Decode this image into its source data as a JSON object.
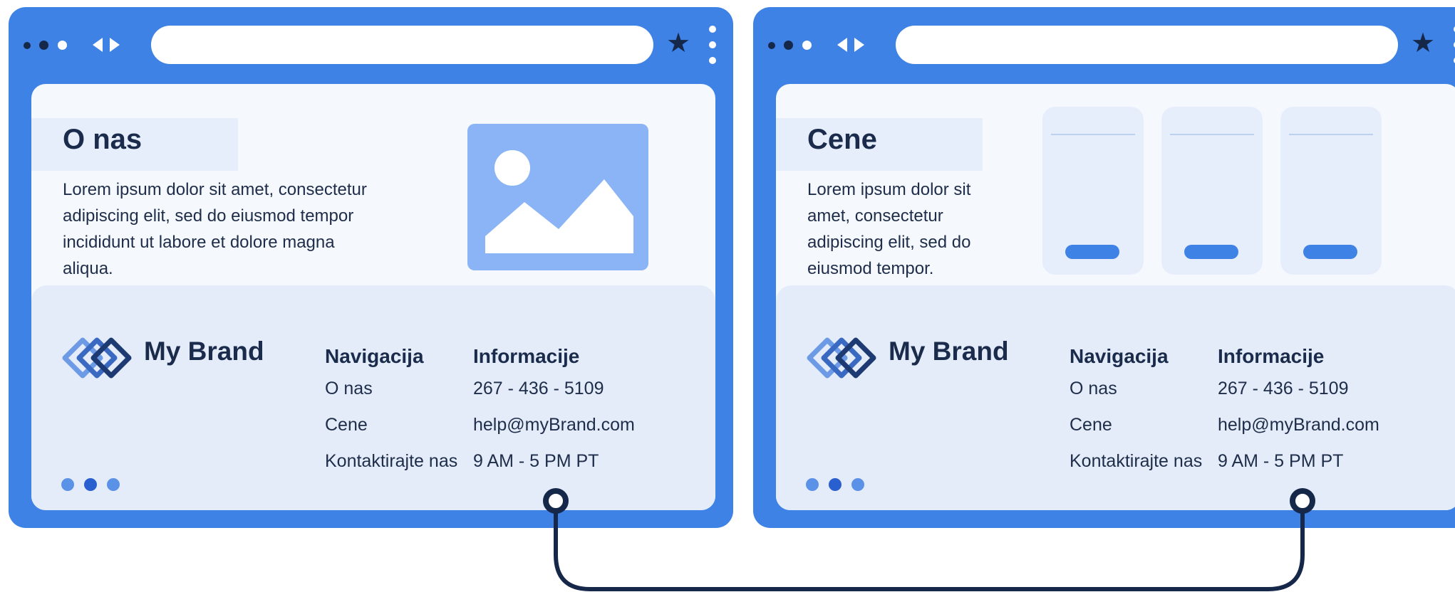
{
  "colors": {
    "window_frame": "#3f82e5",
    "content_bg": "#f5f8fd",
    "footer_bg": "#e4ecf9",
    "image_placeholder": "#8ab4f6",
    "accent": "#3f82e5",
    "dark_navy": "#16284a",
    "connector": "#16284a"
  },
  "windows": [
    {
      "titlebar": {
        "icons": [
          "window-dots-icon",
          "back-arrow-icon",
          "forward-arrow-icon",
          "star-icon",
          "kebab-menu-icon"
        ]
      },
      "page": {
        "title": "O nas",
        "text_lines": [
          "Lorem ipsum dolor sit amet, consectetur",
          "adipiscing elit, sed do eiusmod tempor",
          "incididunt ut labore et dolore magna",
          "aliqua."
        ],
        "media": "image-placeholder-icon"
      },
      "footer": {
        "brand": "My Brand",
        "nav_heading": "Navigacija",
        "nav_items": [
          "O nas",
          "Cene"
        ],
        "contact_label": "Kontaktirajte nas",
        "info_heading": "Informacije",
        "phone": "267 - 436 - 5109",
        "email": "help@myBrand.com",
        "hours": "9 AM - 5 PM PT"
      }
    },
    {
      "titlebar": {
        "icons": [
          "window-dots-icon",
          "back-arrow-icon",
          "forward-arrow-icon",
          "star-icon",
          "kebab-menu-icon"
        ]
      },
      "page": {
        "title": "Cene",
        "text_lines": [
          "Lorem ipsum dolor sit",
          "amet, consectetur",
          "adipiscing elit, sed do",
          "eiusmod tempor."
        ],
        "media": "pricing-cards"
      },
      "footer": {
        "brand": "My Brand",
        "nav_heading": "Navigacija",
        "nav_items": [
          "O nas",
          "Cene"
        ],
        "contact_label": "Kontaktirajte nas",
        "info_heading": "Informacije",
        "phone": "267 - 436 - 5109",
        "email": "help@myBrand.com",
        "hours": "9 AM - 5 PM PT"
      }
    }
  ]
}
